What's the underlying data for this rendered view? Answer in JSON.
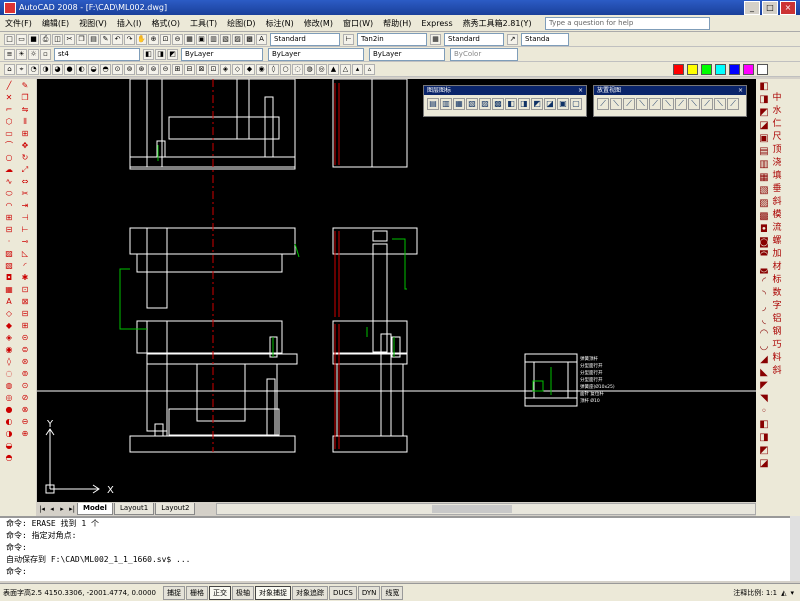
{
  "window": {
    "app_name": "AutoCAD 2008",
    "filename": "[F:\\CAD\\ML002.dwg]",
    "buttons": [
      "_",
      "□",
      "×"
    ]
  },
  "menu": {
    "items": [
      "文件(F)",
      "编辑(E)",
      "视图(V)",
      "插入(I)",
      "格式(O)",
      "工具(T)",
      "绘图(D)",
      "标注(N)",
      "修改(M)",
      "窗口(W)",
      "帮助(H)",
      "Express",
      "燕秀工具箱2.81(Y)"
    ],
    "help_placeholder": "Type a question for help"
  },
  "toolbar1": {
    "text_style": "Standard",
    "dim_style": "Tan2in",
    "table_style": "Standard",
    "extra_style": "Standa"
  },
  "toolbar2": {
    "layer": "st4",
    "color": "ByLayer",
    "linetype": "ByLayer",
    "lineweight": "ByLayer",
    "plotstyle": "ByColor"
  },
  "float_toolbars": [
    {
      "title": "图层图标"
    },
    {
      "title": "放置视图"
    }
  ],
  "right_panel": [
    "中",
    "水",
    "仁",
    "尺",
    "顶",
    "浇",
    "填",
    "垂",
    "斜",
    "模",
    "流",
    "螺",
    "加",
    "材",
    "标",
    "数",
    "字",
    "铝",
    "钢",
    "巧",
    "料",
    "斜"
  ],
  "legend_labels": [
    "弹簧顶杆",
    "分型面行开",
    "分型面行开",
    "分型面行开",
    "弹簧座(Ø10x25)",
    "面针 复位杆",
    "顶杆 Ø10",
    "位置"
  ],
  "tabs": {
    "model": "Model",
    "layout1": "Layout1",
    "layout2": "Layout2"
  },
  "command_lines": [
    "命令:  ERASE 找到 1 个",
    "命令: 指定对角点:",
    "命令:",
    "自动保存到 F:\\CAD\\ML002_1_1_1660.sv$ ...",
    "命令:"
  ],
  "status": {
    "coords": "表面字高2.5  4150.3306, -2001.4774, 0.0000",
    "buttons": [
      "捕捉",
      "栅格",
      "正交",
      "极轴",
      "对象捕捉",
      "对象追踪",
      "DUCS",
      "DYN",
      "线宽"
    ],
    "active": [
      "正交",
      "对象捕捉"
    ],
    "scale_label": "注释比例: 1:1"
  },
  "colors": {
    "viewport": "#000000",
    "cad_white": "#ffffff",
    "cad_red": "#d00000",
    "cad_green": "#00c000"
  }
}
